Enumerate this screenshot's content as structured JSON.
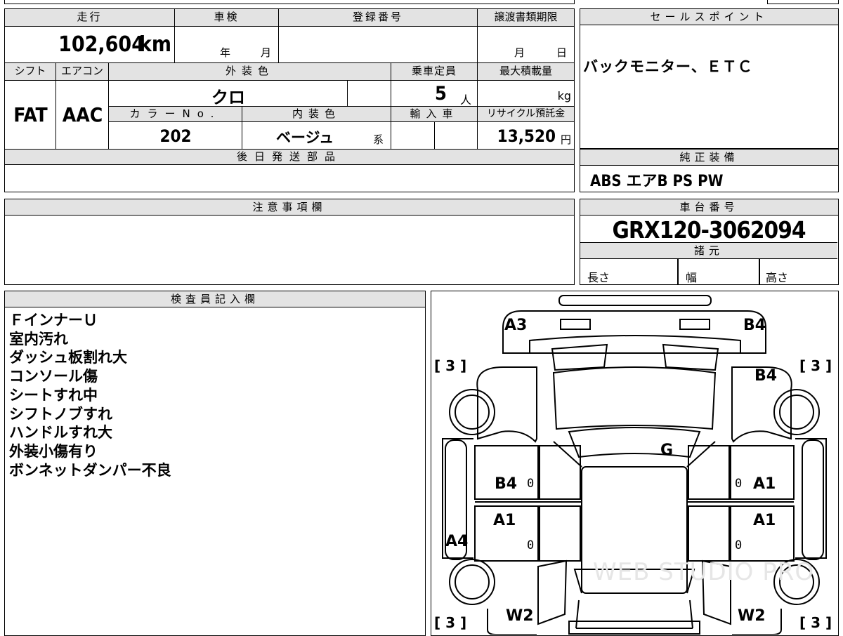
{
  "top_spec": {
    "mileage_label": "走行",
    "mileage": "102,604",
    "mileage_unit": "km",
    "inspection_label": "車検",
    "inspection_year": "年",
    "inspection_month": "月",
    "registration_label": "登録番号",
    "transfer_label": "譲渡書類期限",
    "transfer_month": "月",
    "transfer_day": "日",
    "shift_label": "シフト",
    "shift": "FAT",
    "ac_label": "エアコン",
    "ac": "AAC",
    "exterior_label": "外装色",
    "exterior": "クロ",
    "capacity_label": "乗車定員",
    "capacity": "5",
    "capacity_unit": "人",
    "load_label": "最大積載量",
    "load_unit": "kg",
    "color_no_label": "カラーNo.",
    "color_no": "202",
    "interior_label": "内装色",
    "interior": "ベージュ",
    "interior_suffix": "系",
    "import_label": "輸入車",
    "recycle_label": "リサイクル預託金",
    "recycle": "13,520",
    "recycle_unit": "円",
    "later_parts_label": "後日発送部品"
  },
  "sales_point": {
    "label": "セールスポイント",
    "text": "バックモニター、ＥＴＣ"
  },
  "genuine_equipment": {
    "label": "純正装備",
    "text": "ABS エアB PS PW"
  },
  "notes": {
    "label": "注意事項欄"
  },
  "chassis": {
    "label": "車台番号",
    "number": "GRX120-3062094"
  },
  "specs": {
    "label": "諸元",
    "length": "長さ",
    "width": "幅",
    "height": "高さ"
  },
  "inspector": {
    "label": "検査員記入欄",
    "lines": [
      "ＦインナーＵ",
      "室内汚れ",
      "ダッシュ板割れ大",
      "コンソール傷",
      "シートすれ中",
      "シフトノブすれ",
      "ハンドルすれ大",
      "外装小傷有り",
      "ボンネットダンパー不良"
    ]
  },
  "diagram": {
    "marks": {
      "front_left": "A3",
      "front_right": "B4",
      "right_fender": "B4",
      "hood": "G",
      "left_front_door": "B4",
      "right_front_door": "A1",
      "left_rear_door": "A1",
      "right_rear_door": "A1",
      "left_sill": "A4",
      "rear_left": "W2",
      "rear_right": "W2"
    },
    "tires": {
      "fl": "3",
      "fr": "3",
      "rl": "3",
      "rr": "3"
    },
    "zeros": {
      "z1": "0",
      "z2": "0",
      "z3": "0",
      "z4": "0"
    },
    "watermark": "WEB STUDIO PRO"
  }
}
